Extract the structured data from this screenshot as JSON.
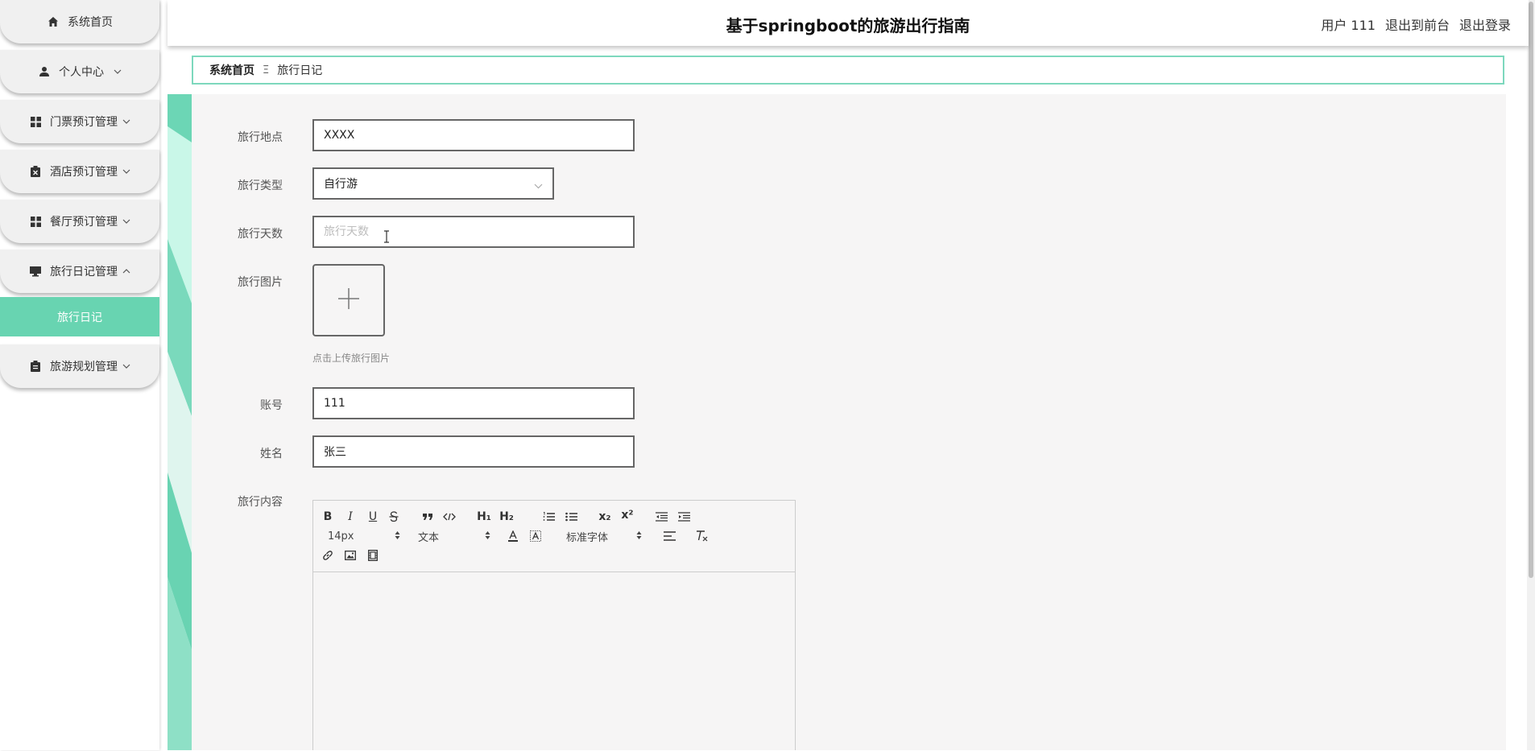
{
  "app": {
    "title": "基于springboot的旅游出行指南"
  },
  "header": {
    "user": "用户 111",
    "to_front": "退出到前台",
    "logout": "退出登录"
  },
  "sidebar": {
    "items": [
      {
        "label": "系统首页",
        "icon": "home-icon"
      },
      {
        "label": "个人中心",
        "icon": "user-icon",
        "expandable": true
      },
      {
        "label": "门票预订管理",
        "icon": "grid-icon",
        "expandable": true
      },
      {
        "label": "酒店预订管理",
        "icon": "clipboard-x-icon",
        "expandable": true
      },
      {
        "label": "餐厅预订管理",
        "icon": "grid-icon",
        "expandable": true
      },
      {
        "label": "旅行日记管理",
        "icon": "monitor-icon",
        "expanded": true
      },
      {
        "label": "旅游规划管理",
        "icon": "clipboard-icon",
        "expandable": true
      }
    ],
    "active_sub": "旅行日记"
  },
  "breadcrumb": {
    "home": "系统首页",
    "separator": "Ξ",
    "current": "旅行日记"
  },
  "form": {
    "location": {
      "label": "旅行地点",
      "value": "XXXX"
    },
    "type": {
      "label": "旅行类型",
      "value": "自行游"
    },
    "days": {
      "label": "旅行天数",
      "placeholder": "旅行天数",
      "value": ""
    },
    "image": {
      "label": "旅行图片",
      "hint": "点击上传旅行图片"
    },
    "account": {
      "label": "账号",
      "value": "111"
    },
    "name": {
      "label": "姓名",
      "value": "张三"
    },
    "content": {
      "label": "旅行内容"
    }
  },
  "editor": {
    "font_size": "14px",
    "header_type": "文本",
    "font_family": "标准字体",
    "buttons": {
      "bold": "B",
      "italic": "I",
      "underline": "U",
      "h1": "H₁",
      "h2": "H₂",
      "sub": "x₂",
      "sup": "x²"
    }
  },
  "colors": {
    "accent": "#68d4b1",
    "breadcrumb_border": "#7dd8bd",
    "content_bg": "#f6f5f5"
  }
}
